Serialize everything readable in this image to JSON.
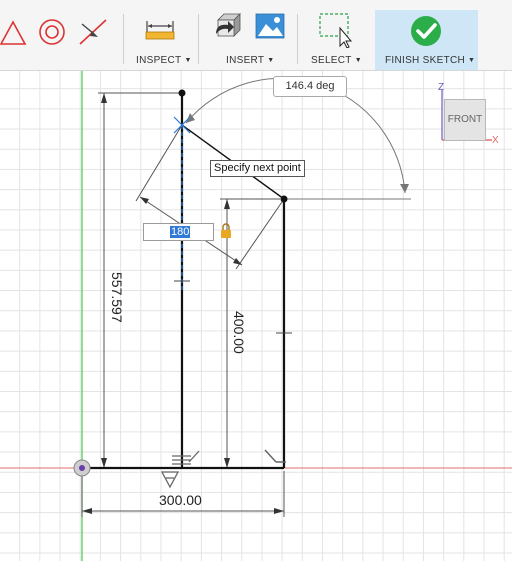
{
  "toolbar": {
    "inspect_label": "INSPECT",
    "insert_label": "INSERT",
    "select_label": "SELECT",
    "finish_label": "FINISH SKETCH",
    "icons": [
      "triangle-icon",
      "circle-icon",
      "trim-icon",
      "measure-icon",
      "insert-derive-icon",
      "insert-image-icon",
      "select-window-icon",
      "finish-check-icon"
    ],
    "accent": "#2bae4a"
  },
  "sketch": {
    "angle_value": "146.4 deg",
    "tooltip": "Specify next point",
    "length_input": "180",
    "dim_height_left": "557.597",
    "dim_height_right": "400.00",
    "dim_width": "300.00"
  },
  "viewcube": {
    "face_label": "FRONT",
    "axis_z": "Z",
    "axis_x": "X"
  },
  "colors": {
    "x_axis": "#e26b6b",
    "y_axis": "#4cc44c",
    "sketch_line": "#000000",
    "dimension": "#555555",
    "highlight": "#2f7ad6"
  }
}
